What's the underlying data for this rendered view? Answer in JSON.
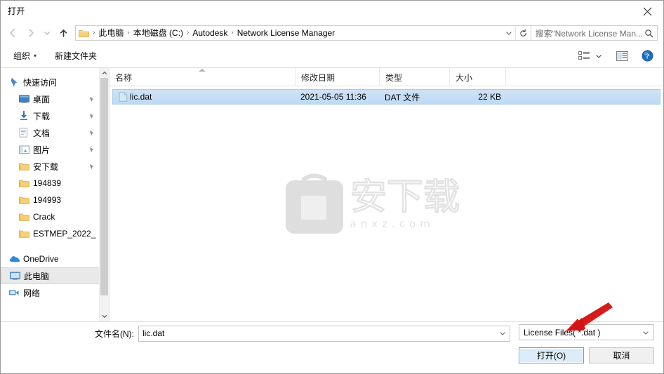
{
  "window": {
    "title": "打开",
    "close_icon": "close-icon"
  },
  "nav": {
    "back_icon": "back-arrow-icon",
    "forward_icon": "forward-arrow-icon",
    "recent_icon": "chevron-down-icon",
    "up_icon": "up-arrow-icon",
    "folder_icon": "folder-icon",
    "breadcrumbs": [
      "此电脑",
      "本地磁盘 (C:)",
      "Autodesk",
      "Network License Manager"
    ],
    "separator": "›",
    "dropdown_icon": "chevron-down-icon",
    "refresh_icon": "refresh-icon",
    "search_placeholder": "搜索“Network License Man...",
    "search_icon": "search-icon"
  },
  "toolbar": {
    "organize_label": "组织",
    "organize_caret": "▾",
    "new_folder_label": "新建文件夹",
    "view_icon": "view-list-icon",
    "view_caret_icon": "chevron-down-icon",
    "preview_icon": "preview-pane-icon",
    "help_icon": "help-icon"
  },
  "sidebar": {
    "items": [
      {
        "label": "快速访问",
        "icon": "quick-access-pin-icon",
        "indent": false,
        "pinned": false,
        "selected": false
      },
      {
        "label": "桌面",
        "icon": "desktop-icon",
        "indent": true,
        "pinned": true,
        "selected": false
      },
      {
        "label": "下载",
        "icon": "downloads-icon",
        "indent": true,
        "pinned": true,
        "selected": false
      },
      {
        "label": "文档",
        "icon": "documents-icon",
        "indent": true,
        "pinned": true,
        "selected": false
      },
      {
        "label": "图片",
        "icon": "pictures-icon",
        "indent": true,
        "pinned": true,
        "selected": false
      },
      {
        "label": "安下载",
        "icon": "folder-icon",
        "indent": true,
        "pinned": true,
        "selected": false
      },
      {
        "label": "194839",
        "icon": "folder-icon",
        "indent": true,
        "pinned": false,
        "selected": false
      },
      {
        "label": "194993",
        "icon": "folder-icon",
        "indent": true,
        "pinned": false,
        "selected": false
      },
      {
        "label": "Crack",
        "icon": "folder-icon",
        "indent": true,
        "pinned": false,
        "selected": false
      },
      {
        "label": "ESTMEP_2022_",
        "icon": "folder-icon",
        "indent": true,
        "pinned": false,
        "selected": false
      },
      {
        "label": "OneDrive",
        "icon": "onedrive-icon",
        "indent": false,
        "pinned": false,
        "selected": false
      },
      {
        "label": "此电脑",
        "icon": "this-pc-icon",
        "indent": false,
        "pinned": false,
        "selected": true
      },
      {
        "label": "网络",
        "icon": "network-icon",
        "indent": false,
        "pinned": false,
        "selected": false
      }
    ],
    "scroll_up_icon": "chevron-up-icon",
    "scroll_down_icon": "chevron-down-icon"
  },
  "filelist": {
    "columns": [
      {
        "key": "name",
        "label": "名称",
        "sorted": true
      },
      {
        "key": "date",
        "label": "修改日期",
        "sorted": false
      },
      {
        "key": "type",
        "label": "类型",
        "sorted": false
      },
      {
        "key": "size",
        "label": "大小",
        "sorted": false
      }
    ],
    "rows": [
      {
        "icon": "dat-file-icon",
        "name": "lic.dat",
        "date": "2021-05-05 11:36",
        "type": "DAT 文件",
        "size": "22 KB",
        "selected": true
      }
    ]
  },
  "watermark": {
    "cn": "安下载",
    "domain": "anxz.com",
    "icon": "bag-icon"
  },
  "footer": {
    "filename_label": "文件名(N):",
    "filename_value": "lic.dat",
    "filename_caret_icon": "chevron-down-icon",
    "filetype_value": "License Files( *.dat )",
    "filetype_caret_icon": "chevron-down-icon",
    "open_button": "打开(O)",
    "cancel_button": "取消"
  },
  "annotation": {
    "arrow_color": "#e01b1b",
    "arrow_name": "red-pointer-arrow"
  },
  "colors": {
    "selection_blue": "#bfd9f3",
    "selection_border": "#a8cced",
    "folder_yellow": "#f5c963",
    "accent_blue": "#2b7cd3",
    "watermark_gray": "#e2e2e2"
  }
}
